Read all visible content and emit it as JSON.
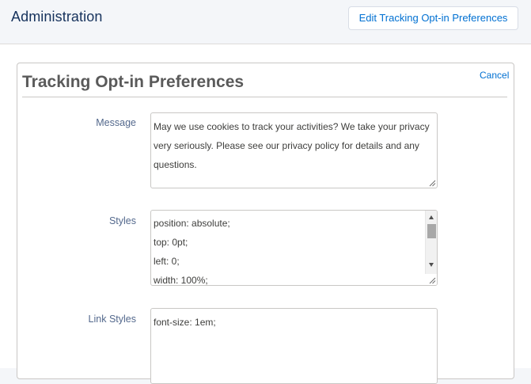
{
  "header": {
    "title": "Administration",
    "edit_button_label": "Edit Tracking Opt-in Preferences"
  },
  "card": {
    "title": "Tracking Opt-in Preferences",
    "cancel_label": "Cancel",
    "fields": {
      "message": {
        "label": "Message",
        "lines": [
          "May we use cookies to track your activities? We take your privacy",
          "very seriously. Please see our privacy policy for details and any",
          "questions."
        ]
      },
      "styles": {
        "label": "Styles",
        "lines": [
          "position: absolute;",
          "top: 0pt;",
          "left: 0;",
          "width: 100%;"
        ]
      },
      "link_styles": {
        "label": "Link Styles",
        "lines": [
          "font-size: 1em;"
        ]
      }
    }
  },
  "icons": {
    "resize_grip": "resize-grip-icon",
    "scroll_up": "scroll-up-arrow-icon",
    "scroll_down": "scroll-down-arrow-icon"
  },
  "colors": {
    "accent": "#0070d2",
    "title": "#16325c",
    "label": "#54698d"
  }
}
